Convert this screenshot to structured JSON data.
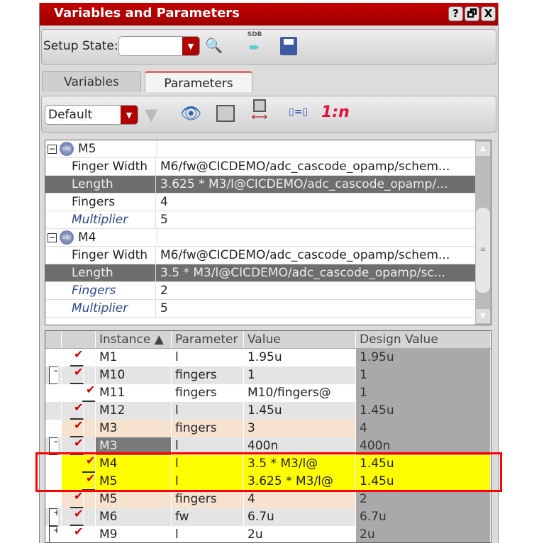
{
  "window": {
    "title": "Variables and Parameters",
    "buttons": [
      "?",
      "🗗",
      "X"
    ]
  },
  "toolbar": {
    "setup_state_label": "Setup State:",
    "setup_state_value": "",
    "sdb_label": "SDB"
  },
  "tabs": [
    {
      "label": "Variables",
      "active": false
    },
    {
      "label": "Parameters",
      "active": true
    }
  ],
  "filter": {
    "view_value": "Default",
    "one_to_n": "1:n"
  },
  "property_tree": [
    {
      "type": "instance",
      "name": "M5",
      "rows": [
        {
          "key": "Finger Width",
          "value": "M6/fw@CICDEMO/adc_cascode_opamp/schem...",
          "selected": false,
          "italic": false
        },
        {
          "key": "Length",
          "value": "3.625 * M3/l@CICDEMO/adc_cascode_opamp/...",
          "selected": true,
          "italic": false
        },
        {
          "key": "Fingers",
          "value": "4",
          "selected": false,
          "italic": false
        },
        {
          "key": "Multiplier",
          "value": "5",
          "selected": false,
          "italic": true
        }
      ]
    },
    {
      "type": "instance",
      "name": "M4",
      "rows": [
        {
          "key": "Finger Width",
          "value": "M6/fw@CICDEMO/adc_cascode_opamp/schem...",
          "selected": false,
          "italic": false
        },
        {
          "key": "Length",
          "value": "3.5 * M3/l@CICDEMO/adc_cascode_opamp/sc...",
          "selected": true,
          "italic": false
        },
        {
          "key": "Fingers",
          "value": "2",
          "selected": false,
          "italic": true
        },
        {
          "key": "Multiplier",
          "value": "5",
          "selected": false,
          "italic": true
        }
      ]
    }
  ],
  "table": {
    "headers": [
      "Instance ▲",
      "Parameter",
      "Value",
      "Design Value"
    ],
    "rows": [
      {
        "exp": "",
        "indent": 0,
        "instance": "M1",
        "parameter": "l",
        "value": "1.95u",
        "design": "1.95u",
        "style": "w"
      },
      {
        "exp": "−",
        "indent": 0,
        "instance": "M10",
        "parameter": "fingers",
        "value": "1",
        "design": "1",
        "style": "g"
      },
      {
        "exp": "",
        "indent": 1,
        "instance": "M11",
        "parameter": "fingers",
        "value": "M10/fingers@",
        "design": "1",
        "style": "w"
      },
      {
        "exp": "",
        "indent": 0,
        "instance": "M12",
        "parameter": "l",
        "value": "1.45u",
        "design": "1.45u",
        "style": "g"
      },
      {
        "exp": "",
        "indent": 0,
        "instance": "M3",
        "parameter": "fingers",
        "value": "3",
        "design": "4",
        "style": "o"
      },
      {
        "exp": "−",
        "indent": 0,
        "instance": "M3",
        "parameter": "l",
        "value": "400n",
        "design": "400n",
        "style": "g",
        "selected": true
      },
      {
        "exp": "",
        "indent": 1,
        "instance": "M4",
        "parameter": "l",
        "value": "3.5 * M3/l@",
        "design": "1.45u",
        "style": "y"
      },
      {
        "exp": "",
        "indent": 1,
        "instance": "M5",
        "parameter": "l",
        "value": "3.625 * M3/l@",
        "design": "1.45u",
        "style": "y"
      },
      {
        "exp": "",
        "indent": 0,
        "instance": "M5",
        "parameter": "fingers",
        "value": "4",
        "design": "2",
        "style": "o"
      },
      {
        "exp": "+",
        "indent": 0,
        "instance": "M6",
        "parameter": "fw",
        "value": "6.7u",
        "design": "6.7u",
        "style": "g"
      },
      {
        "exp": "+",
        "indent": 0,
        "instance": "M9",
        "parameter": "l",
        "value": "2u",
        "design": "2u",
        "style": "w"
      }
    ]
  },
  "colors": {
    "title_bar": "#b00000",
    "highlight": "#ffff00",
    "annotation_box": "#ff0000",
    "check": "#d00000"
  }
}
